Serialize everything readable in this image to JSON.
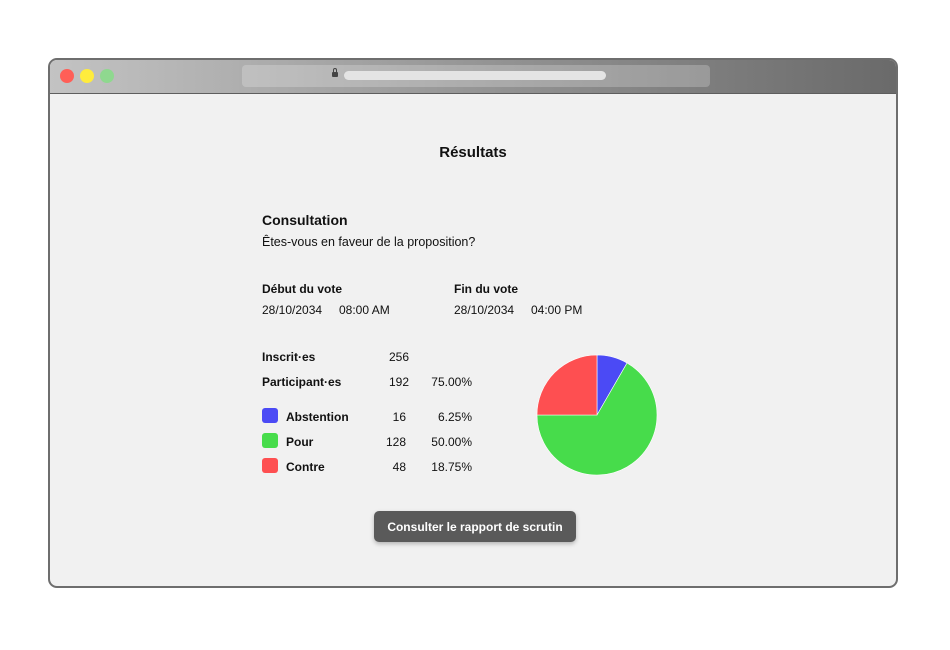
{
  "colors": {
    "abstention": "#4b4af5",
    "pour": "#47dc4b",
    "contre": "#fe4f51"
  },
  "page": {
    "title": "Résultats"
  },
  "consultation": {
    "title": "Consultation",
    "question": "Êtes-vous en faveur de la proposition?"
  },
  "schedule": {
    "start_label": "Début du vote",
    "start_date": "28/10/2034",
    "start_time": "08:00 AM",
    "end_label": "Fin du vote",
    "end_date": "28/10/2034",
    "end_time": "04:00 PM"
  },
  "stats": {
    "registered_label": "Inscrit·es",
    "registered_value": "256",
    "participants_label": "Participant·es",
    "participants_value": "192",
    "participants_pct": "75.00%"
  },
  "results": [
    {
      "label": "Abstention",
      "count": "16",
      "pct": "6.25%"
    },
    {
      "label": "Pour",
      "count": "128",
      "pct": "50.00%"
    },
    {
      "label": "Contre",
      "count": "48",
      "pct": "18.75%"
    }
  ],
  "chart_data": {
    "type": "pie",
    "categories": [
      "Abstention",
      "Pour",
      "Contre"
    ],
    "values": [
      16,
      128,
      48
    ]
  },
  "actions": {
    "report_button": "Consulter le rapport de scrutin"
  }
}
